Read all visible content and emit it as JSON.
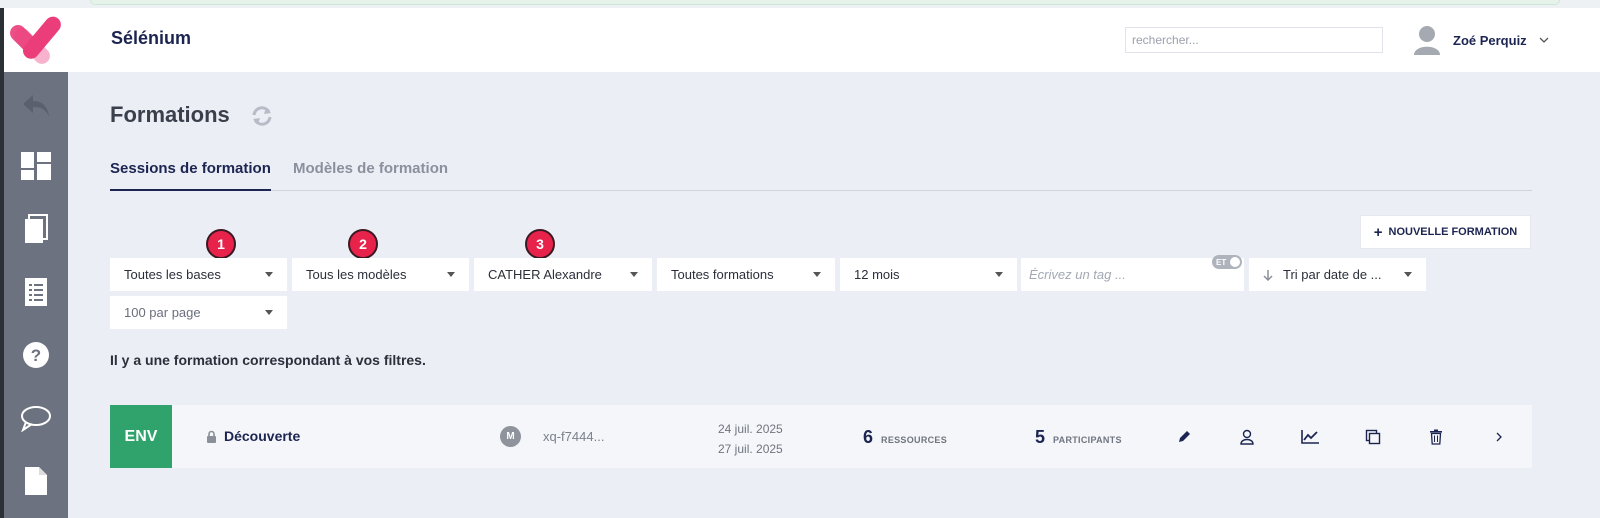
{
  "app": {
    "name": "Sélénium"
  },
  "header": {
    "search_placeholder": "rechercher...",
    "user_name": "Zoé Perquiz"
  },
  "sidebar": {
    "items": [
      {
        "icon": "back-arrow-icon"
      },
      {
        "icon": "dashboard-icon"
      },
      {
        "icon": "documents-icon"
      },
      {
        "icon": "list-icon"
      },
      {
        "icon": "help-icon"
      },
      {
        "icon": "chat-icon"
      },
      {
        "icon": "file-icon"
      }
    ]
  },
  "page": {
    "title": "Formations",
    "tabs": [
      {
        "label": "Sessions de formation",
        "active": true
      },
      {
        "label": "Modèles de formation",
        "active": false
      }
    ],
    "new_button_label": "NOUVELLE FORMATION",
    "badges": [
      "1",
      "2",
      "3"
    ],
    "filters": {
      "bases": "Toutes les bases",
      "models": "Tous les modèles",
      "person": "CATHER Alexandre",
      "formations": "Toutes formations",
      "period": "12 mois",
      "tag_placeholder": "Écrivez un tag ...",
      "tag_toggle": "ET",
      "sort": "Tri par date de ...",
      "per_page": "100 par page"
    },
    "result_message": "Il y a une formation correspondant à vos filtres.",
    "rows": [
      {
        "env": "ENV",
        "name": "Découverte",
        "model_initial": "M",
        "code": "xq-f7444...",
        "date_start": "24 juil. 2025",
        "date_end": "27 juil. 2025",
        "resources_count": "6",
        "resources_label": "RESSOURCES",
        "participants_count": "5",
        "participants_label": "PARTICIPANTS"
      }
    ]
  },
  "colors": {
    "brand_navy": "#1c2551",
    "sidebar": "#6c7280",
    "background": "#eceef5",
    "badge_red": "#e8234b",
    "env_green": "#2fa36b",
    "logo_pink": "#ea3d7a"
  }
}
